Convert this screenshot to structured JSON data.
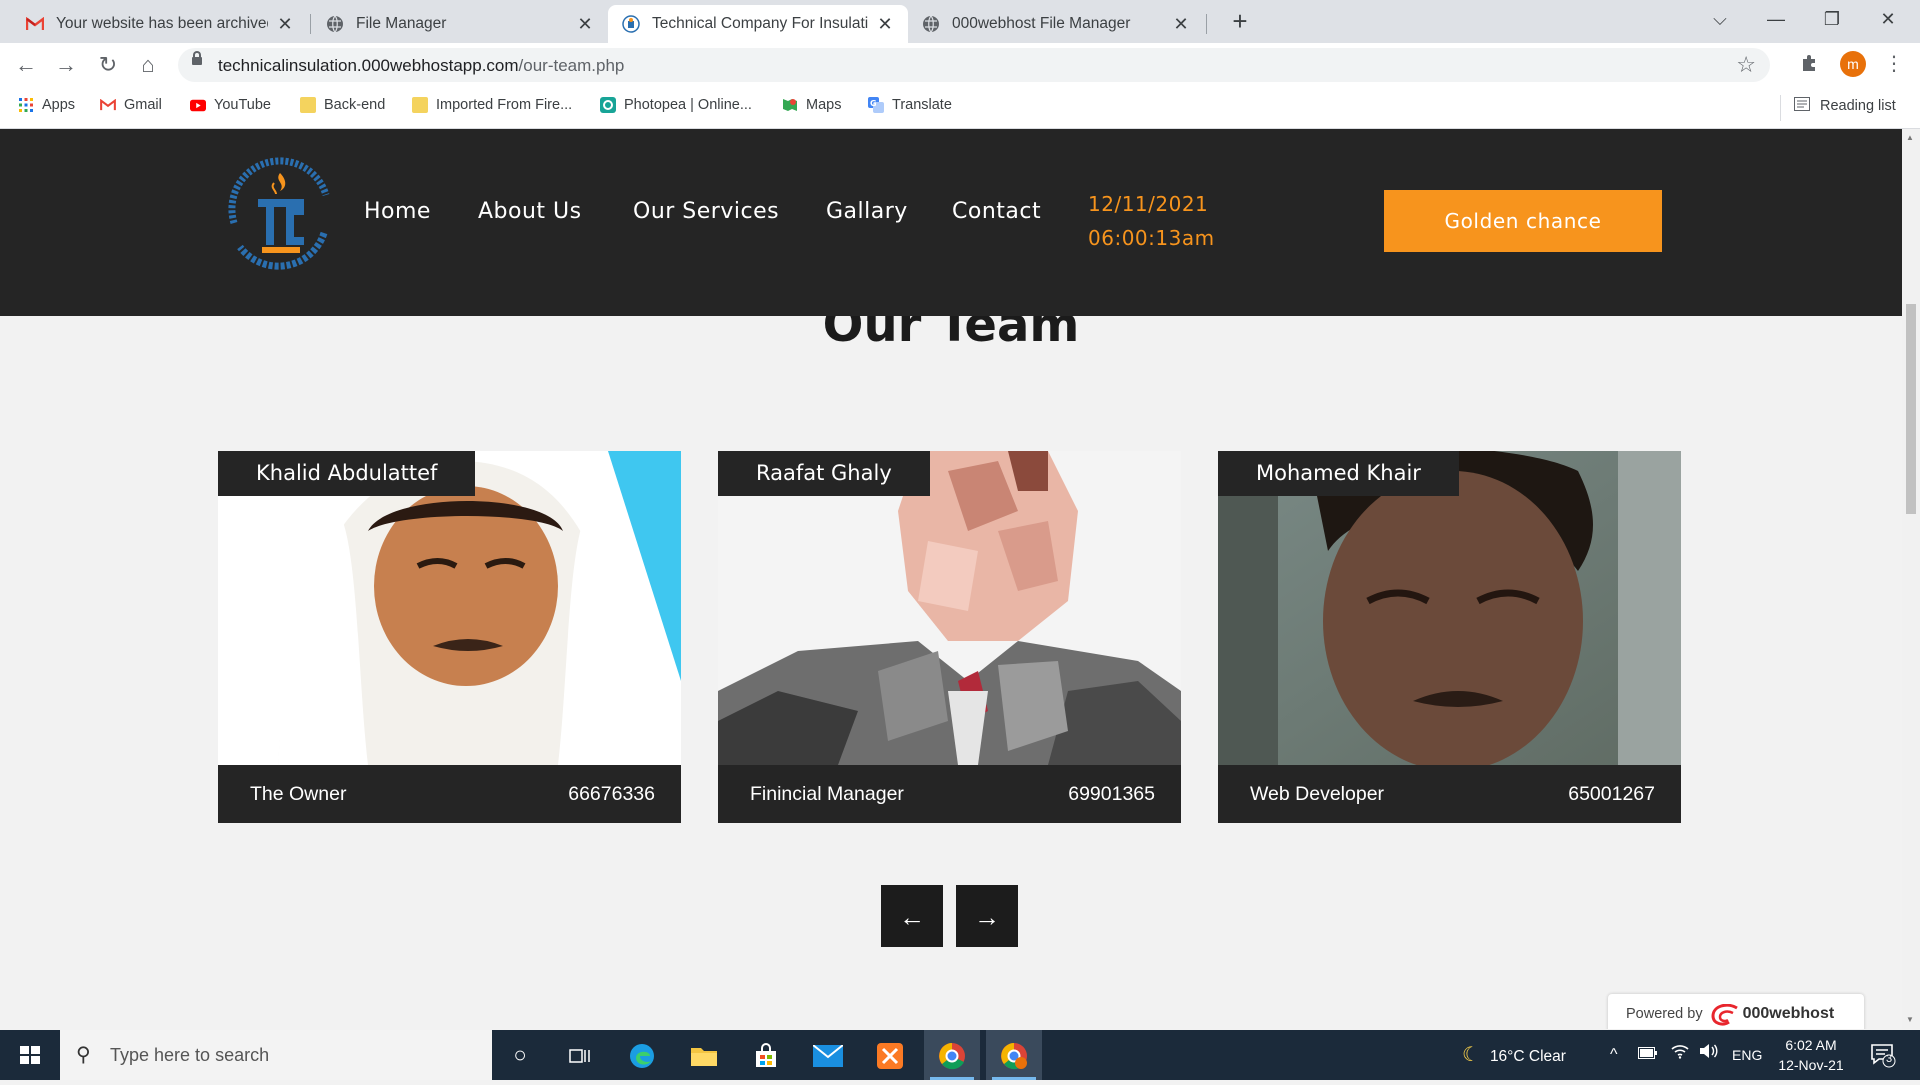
{
  "browser": {
    "tabs": [
      {
        "title": "Your website has been archived -",
        "icon": "gmail-icon"
      },
      {
        "title": "File Manager",
        "icon": "globe-icon"
      },
      {
        "title": "Technical Company For Insulation",
        "icon": "site-logo-icon",
        "active": true
      },
      {
        "title": "000webhost File Manager",
        "icon": "globe-icon"
      }
    ],
    "url_host": "technicalinsulation.000webhostapp.com",
    "url_path": "/our-team.php",
    "avatar_letter": "m",
    "bookmarks": [
      {
        "label": "Apps",
        "icon": "apps-grid-icon"
      },
      {
        "label": "Gmail",
        "icon": "gmail-icon"
      },
      {
        "label": "YouTube",
        "icon": "youtube-icon"
      },
      {
        "label": "Back-end",
        "icon": "folder-icon"
      },
      {
        "label": "Imported From Fire...",
        "icon": "folder-icon"
      },
      {
        "label": "Photopea | Online...",
        "icon": "photopea-icon"
      },
      {
        "label": "Maps",
        "icon": "maps-icon"
      },
      {
        "label": "Translate",
        "icon": "translate-icon"
      }
    ],
    "reading_list": "Reading list"
  },
  "site": {
    "nav": [
      "Home",
      "About Us",
      "Our Services",
      "Gallary",
      "Contact"
    ],
    "date": "12/11/2021",
    "time": "06:00:13am",
    "cta": "Golden chance",
    "section_title": "Our Team",
    "team": [
      {
        "name": "Khalid Abdulattef",
        "role": "The Owner",
        "phone": "66676336"
      },
      {
        "name": "Raafat Ghaly",
        "role": "Finincial Manager",
        "phone": "69901365"
      },
      {
        "name": "Mohamed Khair",
        "role": "Web Developer",
        "phone": "65001267"
      }
    ],
    "prev_arrow": "←",
    "next_arrow": "→",
    "powered_by": "Powered by",
    "powered_brand": "000webhost"
  },
  "taskbar": {
    "search_placeholder": "Type here to search",
    "weather": "16°C  Clear",
    "lang": "ENG",
    "clock_time": "6:02 AM",
    "clock_date": "12-Nov-21",
    "notifications": "3"
  },
  "colors": {
    "accent": "#f7941d",
    "header_bg": "#252525",
    "page_bg": "#f2f2f2"
  }
}
